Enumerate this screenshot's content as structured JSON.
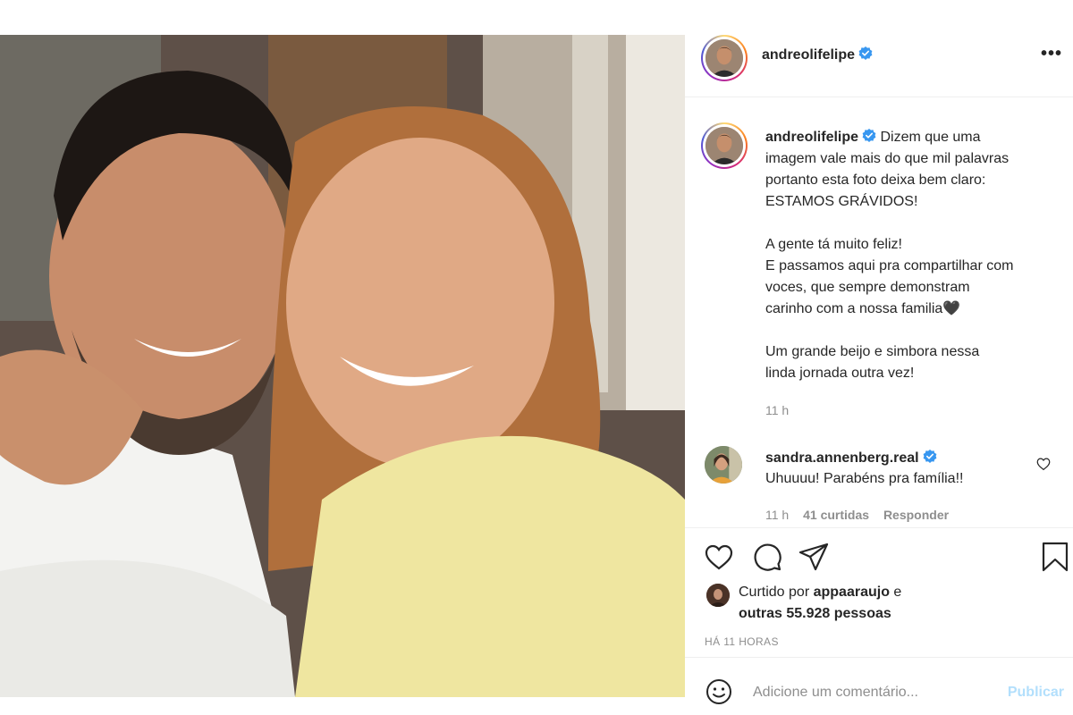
{
  "post": {
    "author": {
      "username": "andreolifelipe",
      "verified": true,
      "avatar_icon": "profile-avatar"
    },
    "more_icon": "ellipsis-icon",
    "more_label": "•••",
    "caption": {
      "lines_1": [
        "Dizem que uma",
        "imagem vale mais do que mil palavras",
        "portanto esta foto deixa bem claro:",
        "ESTAMOS GRÁVIDOS!"
      ],
      "lines_2": [
        "A gente tá muito feliz!",
        "E passamos aqui pra compartilhar com",
        "voces, que sempre demonstram",
        "carinho com a nossa familia🖤"
      ],
      "lines_3": [
        "Um grande beijo e simbora nessa",
        "linda jornada outra vez!"
      ],
      "time": "11 h"
    },
    "comment": {
      "username": "sandra.annenberg.real",
      "verified": true,
      "text": "Uhuuuu! Parabéns pra família!!",
      "time": "11 h",
      "likes": "41 curtidas",
      "reply": "Responder"
    },
    "likes": {
      "prefix": "Curtido por",
      "user": "appaaraujo",
      "middle": "e",
      "others": "outras 55.928 pessoas"
    },
    "posted_ago": "HÁ 11 HORAS",
    "add_comment": {
      "placeholder": "Adicione um comentário...",
      "publish": "Publicar"
    }
  },
  "colors": {
    "text": "#262626",
    "muted": "#8e8e8e",
    "verified": "#3897f0",
    "publish_disabled": "#b2dffc",
    "divider": "#efefef"
  }
}
